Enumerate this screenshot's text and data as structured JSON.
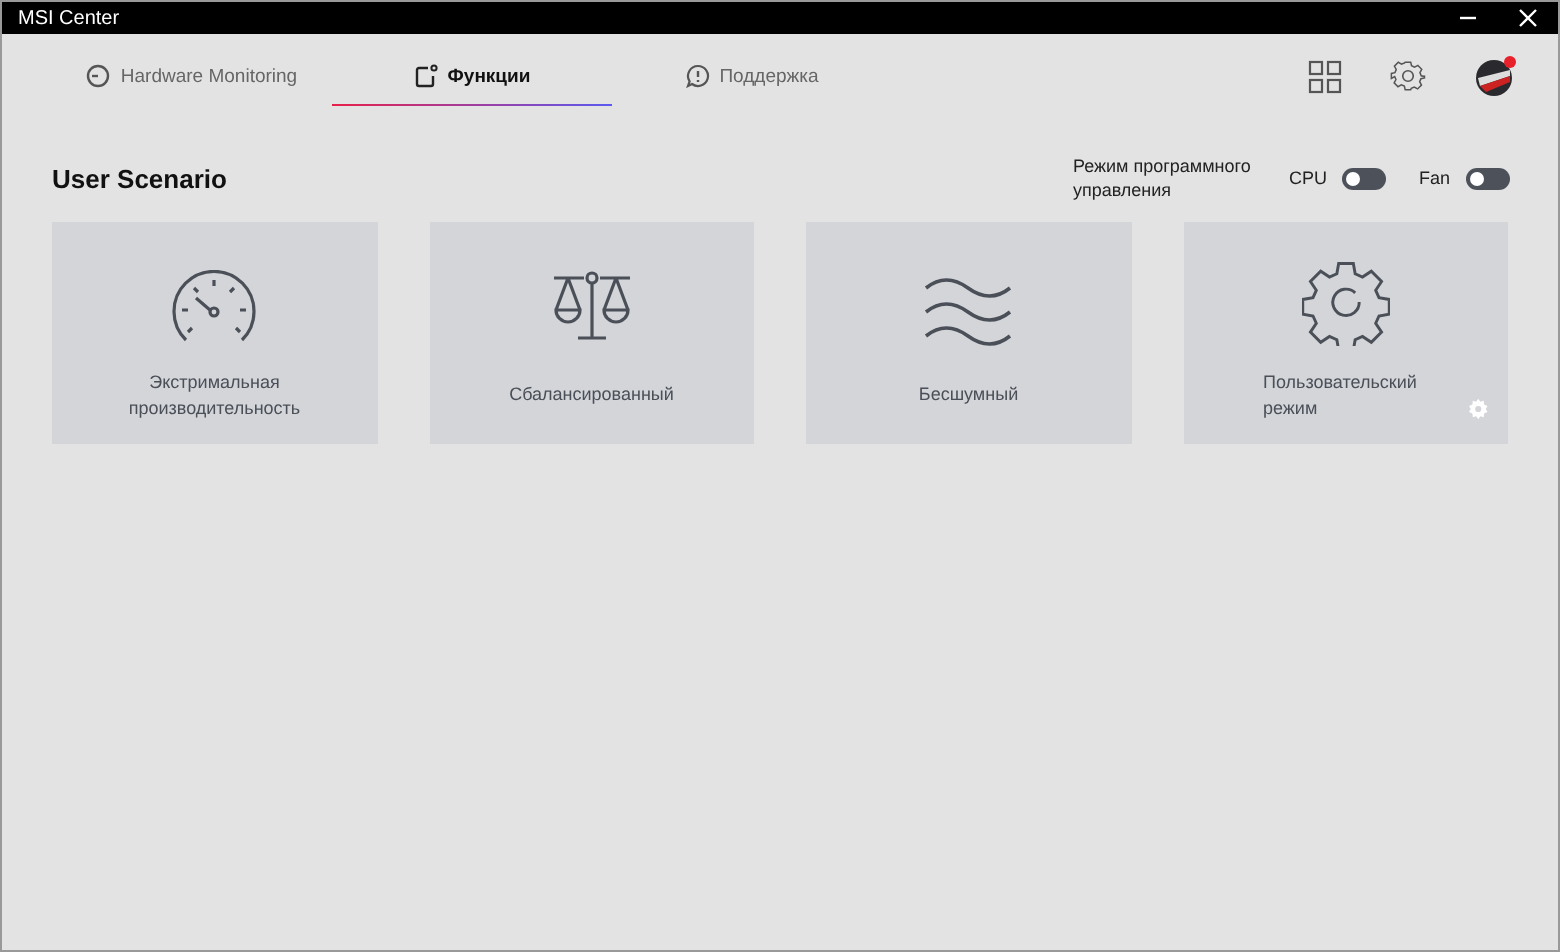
{
  "window": {
    "title": "MSI Center"
  },
  "tabs": [
    {
      "label": "Hardware Monitoring",
      "kind": "monitor",
      "selected": false
    },
    {
      "label": "Функции",
      "kind": "features",
      "selected": true
    },
    {
      "label": "Поддержка",
      "kind": "support",
      "selected": false
    }
  ],
  "section": {
    "title": "User Scenario",
    "mode_label": "Режим программного управления"
  },
  "toggles": [
    {
      "label": "CPU",
      "on": false
    },
    {
      "label": "Fan",
      "on": false
    }
  ],
  "scenarios": [
    {
      "label": "Экстримальная производительность",
      "kind": "speed",
      "settings_button": false
    },
    {
      "label": "Сбалансированный",
      "kind": "balance",
      "settings_button": false
    },
    {
      "label": "Бесшумный",
      "kind": "silent",
      "settings_button": false
    },
    {
      "label": "Пользовательский режим",
      "kind": "custom",
      "settings_button": true
    }
  ]
}
